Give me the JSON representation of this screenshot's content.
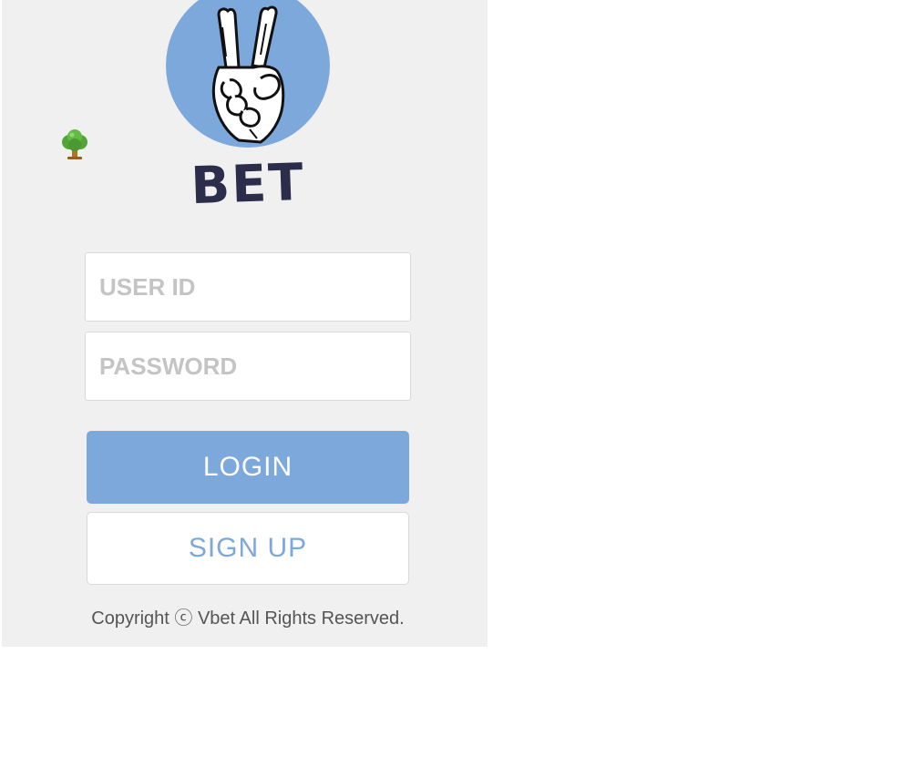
{
  "brand": {
    "logo_icon": "peace-hand-icon",
    "name": "BET",
    "circle_color": "#7da8dc",
    "text_color": "#2b2d4a"
  },
  "decor": {
    "tree_icon": "tree-icon"
  },
  "form": {
    "user_id_placeholder": "USER ID",
    "password_placeholder": "PASSWORD",
    "login_label": "LOGIN",
    "signup_label": "SIGN UP"
  },
  "footer": {
    "copyright": "Copyright ⓒ Vbet All Rights Reserved."
  },
  "colors": {
    "accent": "#7da8dc",
    "panel_bg": "#f0f0f0"
  }
}
